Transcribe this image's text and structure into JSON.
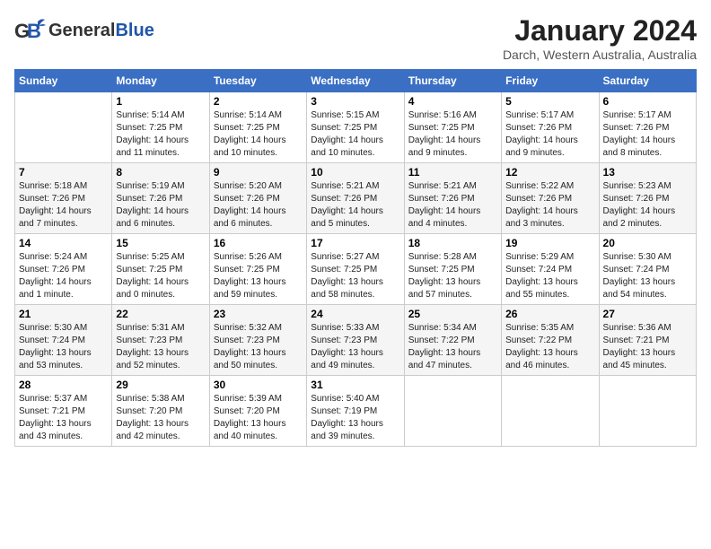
{
  "header": {
    "logo_general": "General",
    "logo_blue": "Blue",
    "title": "January 2024",
    "location": "Darch, Western Australia, Australia"
  },
  "weekdays": [
    "Sunday",
    "Monday",
    "Tuesday",
    "Wednesday",
    "Thursday",
    "Friday",
    "Saturday"
  ],
  "weeks": [
    [
      {
        "day": "",
        "info": ""
      },
      {
        "day": "1",
        "info": "Sunrise: 5:14 AM\nSunset: 7:25 PM\nDaylight: 14 hours\nand 11 minutes."
      },
      {
        "day": "2",
        "info": "Sunrise: 5:14 AM\nSunset: 7:25 PM\nDaylight: 14 hours\nand 10 minutes."
      },
      {
        "day": "3",
        "info": "Sunrise: 5:15 AM\nSunset: 7:25 PM\nDaylight: 14 hours\nand 10 minutes."
      },
      {
        "day": "4",
        "info": "Sunrise: 5:16 AM\nSunset: 7:25 PM\nDaylight: 14 hours\nand 9 minutes."
      },
      {
        "day": "5",
        "info": "Sunrise: 5:17 AM\nSunset: 7:26 PM\nDaylight: 14 hours\nand 9 minutes."
      },
      {
        "day": "6",
        "info": "Sunrise: 5:17 AM\nSunset: 7:26 PM\nDaylight: 14 hours\nand 8 minutes."
      }
    ],
    [
      {
        "day": "7",
        "info": "Sunrise: 5:18 AM\nSunset: 7:26 PM\nDaylight: 14 hours\nand 7 minutes."
      },
      {
        "day": "8",
        "info": "Sunrise: 5:19 AM\nSunset: 7:26 PM\nDaylight: 14 hours\nand 6 minutes."
      },
      {
        "day": "9",
        "info": "Sunrise: 5:20 AM\nSunset: 7:26 PM\nDaylight: 14 hours\nand 6 minutes."
      },
      {
        "day": "10",
        "info": "Sunrise: 5:21 AM\nSunset: 7:26 PM\nDaylight: 14 hours\nand 5 minutes."
      },
      {
        "day": "11",
        "info": "Sunrise: 5:21 AM\nSunset: 7:26 PM\nDaylight: 14 hours\nand 4 minutes."
      },
      {
        "day": "12",
        "info": "Sunrise: 5:22 AM\nSunset: 7:26 PM\nDaylight: 14 hours\nand 3 minutes."
      },
      {
        "day": "13",
        "info": "Sunrise: 5:23 AM\nSunset: 7:26 PM\nDaylight: 14 hours\nand 2 minutes."
      }
    ],
    [
      {
        "day": "14",
        "info": "Sunrise: 5:24 AM\nSunset: 7:26 PM\nDaylight: 14 hours\nand 1 minute."
      },
      {
        "day": "15",
        "info": "Sunrise: 5:25 AM\nSunset: 7:25 PM\nDaylight: 14 hours\nand 0 minutes."
      },
      {
        "day": "16",
        "info": "Sunrise: 5:26 AM\nSunset: 7:25 PM\nDaylight: 13 hours\nand 59 minutes."
      },
      {
        "day": "17",
        "info": "Sunrise: 5:27 AM\nSunset: 7:25 PM\nDaylight: 13 hours\nand 58 minutes."
      },
      {
        "day": "18",
        "info": "Sunrise: 5:28 AM\nSunset: 7:25 PM\nDaylight: 13 hours\nand 57 minutes."
      },
      {
        "day": "19",
        "info": "Sunrise: 5:29 AM\nSunset: 7:24 PM\nDaylight: 13 hours\nand 55 minutes."
      },
      {
        "day": "20",
        "info": "Sunrise: 5:30 AM\nSunset: 7:24 PM\nDaylight: 13 hours\nand 54 minutes."
      }
    ],
    [
      {
        "day": "21",
        "info": "Sunrise: 5:30 AM\nSunset: 7:24 PM\nDaylight: 13 hours\nand 53 minutes."
      },
      {
        "day": "22",
        "info": "Sunrise: 5:31 AM\nSunset: 7:23 PM\nDaylight: 13 hours\nand 52 minutes."
      },
      {
        "day": "23",
        "info": "Sunrise: 5:32 AM\nSunset: 7:23 PM\nDaylight: 13 hours\nand 50 minutes."
      },
      {
        "day": "24",
        "info": "Sunrise: 5:33 AM\nSunset: 7:23 PM\nDaylight: 13 hours\nand 49 minutes."
      },
      {
        "day": "25",
        "info": "Sunrise: 5:34 AM\nSunset: 7:22 PM\nDaylight: 13 hours\nand 47 minutes."
      },
      {
        "day": "26",
        "info": "Sunrise: 5:35 AM\nSunset: 7:22 PM\nDaylight: 13 hours\nand 46 minutes."
      },
      {
        "day": "27",
        "info": "Sunrise: 5:36 AM\nSunset: 7:21 PM\nDaylight: 13 hours\nand 45 minutes."
      }
    ],
    [
      {
        "day": "28",
        "info": "Sunrise: 5:37 AM\nSunset: 7:21 PM\nDaylight: 13 hours\nand 43 minutes."
      },
      {
        "day": "29",
        "info": "Sunrise: 5:38 AM\nSunset: 7:20 PM\nDaylight: 13 hours\nand 42 minutes."
      },
      {
        "day": "30",
        "info": "Sunrise: 5:39 AM\nSunset: 7:20 PM\nDaylight: 13 hours\nand 40 minutes."
      },
      {
        "day": "31",
        "info": "Sunrise: 5:40 AM\nSunset: 7:19 PM\nDaylight: 13 hours\nand 39 minutes."
      },
      {
        "day": "",
        "info": ""
      },
      {
        "day": "",
        "info": ""
      },
      {
        "day": "",
        "info": ""
      }
    ]
  ]
}
